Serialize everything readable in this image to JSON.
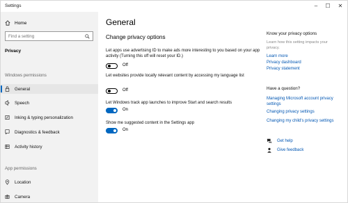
{
  "window": {
    "title": "Settings",
    "minimize": "–",
    "maximize": "☐",
    "close": "✕"
  },
  "sidebar": {
    "home_label": "Home",
    "search_placeholder": "Find a setting",
    "section_title": "Privacy",
    "windows_permissions_label": "Windows permissions",
    "items": [
      {
        "label": "General",
        "icon": "lock-icon"
      },
      {
        "label": "Speech",
        "icon": "speech-icon"
      },
      {
        "label": "Inking & typing personalization",
        "icon": "inking-icon"
      },
      {
        "label": "Diagnostics & feedback",
        "icon": "diagnostics-icon"
      },
      {
        "label": "Activity history",
        "icon": "activity-history-icon"
      }
    ],
    "app_permissions_label": "App permissions",
    "app_items": [
      {
        "label": "Location",
        "icon": "location-icon"
      },
      {
        "label": "Camera",
        "icon": "camera-icon"
      }
    ]
  },
  "main": {
    "title": "General",
    "subtitle": "Change privacy options",
    "settings": [
      {
        "description": "Let apps use advertising ID to make ads more interesting to you based on your app activity (Turning this off will reset your ID.)",
        "state": "Off",
        "on": false
      },
      {
        "description": "Let websites provide locally relevant content by accessing my language list",
        "state": "Off",
        "on": false
      },
      {
        "description": "Let Windows track app launches to improve Start and search results",
        "state": "On",
        "on": true
      },
      {
        "description": "Show me suggested content in the Settings app",
        "state": "On",
        "on": true
      }
    ]
  },
  "right": {
    "know_title": "Know your privacy options",
    "know_text": "Learn how this setting impacts your privacy.",
    "links": [
      "Learn more",
      "Privacy dashboard",
      "Privacy statement"
    ],
    "question_title": "Have a question?",
    "question_links": [
      "Managing Microsoft account privacy settings",
      "Changing privacy settings",
      "Changing my child's privacy settings"
    ],
    "get_help": "Get help",
    "give_feedback": "Give feedback"
  },
  "colors": {
    "accent": "#0067c0",
    "link": "#0056b3",
    "sidebar_bg": "#f2f2f2"
  }
}
